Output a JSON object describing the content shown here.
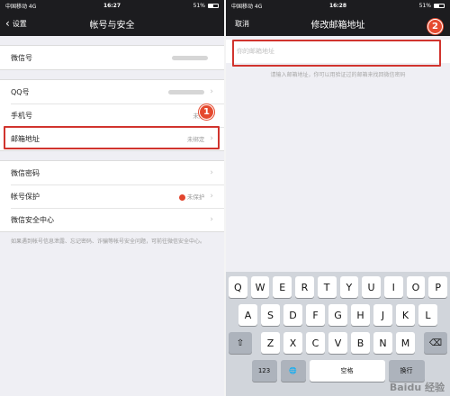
{
  "left": {
    "status": {
      "carrier": "中国移动 4G",
      "time": "16:27",
      "battery": "51%",
      "battery_level": 0.51
    },
    "nav": {
      "back_label": "设置",
      "title": "帐号与安全"
    },
    "groups": [
      [
        {
          "label": "微信号",
          "value": ""
        }
      ],
      [
        {
          "label": "QQ号",
          "value": ""
        },
        {
          "label": "手机号",
          "value": "未绑"
        },
        {
          "label": "邮箱地址",
          "value": "未绑定"
        }
      ],
      [
        {
          "label": "微信密码",
          "value": ""
        },
        {
          "label": "帐号保护",
          "value": "未保护"
        },
        {
          "label": "微信安全中心",
          "value": ""
        }
      ]
    ],
    "footnote": "如果遇到帐号信息泄露、忘记密码、诈骗等帐号安全问题，可前往微信安全中心。",
    "marker": "1"
  },
  "right": {
    "status": {
      "carrier": "中国移动 4G",
      "time": "16:28",
      "battery": "51%",
      "battery_level": 0.51
    },
    "nav": {
      "cancel_label": "取消",
      "title": "修改邮箱地址"
    },
    "input_placeholder": "你的邮箱地址",
    "hint": "请输入邮箱地址，你可以用验证过的邮箱来找回微信密码",
    "marker": "2",
    "keyboard": {
      "row1": [
        "Q",
        "W",
        "E",
        "R",
        "T",
        "Y",
        "U",
        "I",
        "O",
        "P"
      ],
      "row2": [
        "A",
        "S",
        "D",
        "F",
        "G",
        "H",
        "J",
        "K",
        "L"
      ],
      "row3": [
        "Z",
        "X",
        "C",
        "V",
        "B",
        "N",
        "M"
      ],
      "shift": "⇧",
      "delete": "⌫",
      "num": "123",
      "globe": "🌐",
      "space": "空格",
      "return": "换行"
    }
  },
  "watermark": "Baidu 经验"
}
